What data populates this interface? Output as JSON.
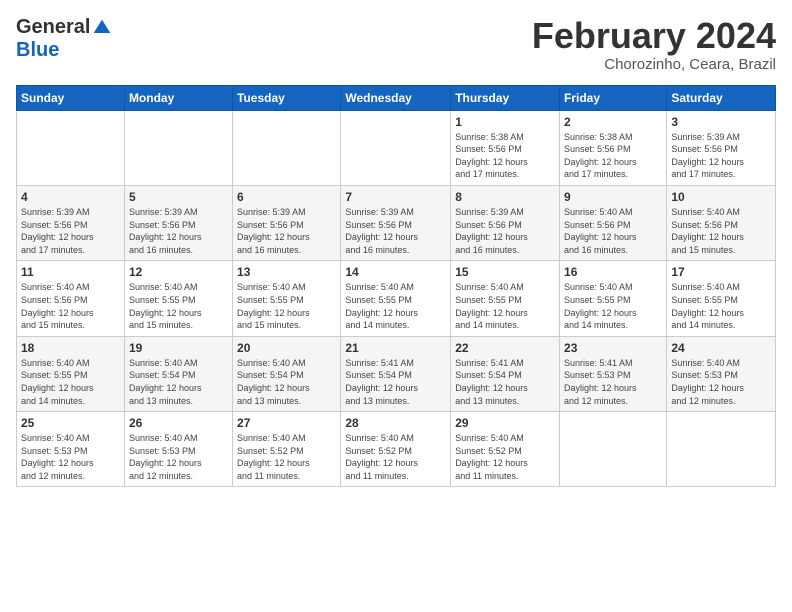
{
  "header": {
    "logo_general": "General",
    "logo_blue": "Blue",
    "month_title": "February 2024",
    "location": "Chorozinho, Ceara, Brazil"
  },
  "weekdays": [
    "Sunday",
    "Monday",
    "Tuesday",
    "Wednesday",
    "Thursday",
    "Friday",
    "Saturday"
  ],
  "weeks": [
    [
      {
        "day": "",
        "info": ""
      },
      {
        "day": "",
        "info": ""
      },
      {
        "day": "",
        "info": ""
      },
      {
        "day": "",
        "info": ""
      },
      {
        "day": "1",
        "info": "Sunrise: 5:38 AM\nSunset: 5:56 PM\nDaylight: 12 hours\nand 17 minutes."
      },
      {
        "day": "2",
        "info": "Sunrise: 5:38 AM\nSunset: 5:56 PM\nDaylight: 12 hours\nand 17 minutes."
      },
      {
        "day": "3",
        "info": "Sunrise: 5:39 AM\nSunset: 5:56 PM\nDaylight: 12 hours\nand 17 minutes."
      }
    ],
    [
      {
        "day": "4",
        "info": "Sunrise: 5:39 AM\nSunset: 5:56 PM\nDaylight: 12 hours\nand 17 minutes."
      },
      {
        "day": "5",
        "info": "Sunrise: 5:39 AM\nSunset: 5:56 PM\nDaylight: 12 hours\nand 16 minutes."
      },
      {
        "day": "6",
        "info": "Sunrise: 5:39 AM\nSunset: 5:56 PM\nDaylight: 12 hours\nand 16 minutes."
      },
      {
        "day": "7",
        "info": "Sunrise: 5:39 AM\nSunset: 5:56 PM\nDaylight: 12 hours\nand 16 minutes."
      },
      {
        "day": "8",
        "info": "Sunrise: 5:39 AM\nSunset: 5:56 PM\nDaylight: 12 hours\nand 16 minutes."
      },
      {
        "day": "9",
        "info": "Sunrise: 5:40 AM\nSunset: 5:56 PM\nDaylight: 12 hours\nand 16 minutes."
      },
      {
        "day": "10",
        "info": "Sunrise: 5:40 AM\nSunset: 5:56 PM\nDaylight: 12 hours\nand 15 minutes."
      }
    ],
    [
      {
        "day": "11",
        "info": "Sunrise: 5:40 AM\nSunset: 5:56 PM\nDaylight: 12 hours\nand 15 minutes."
      },
      {
        "day": "12",
        "info": "Sunrise: 5:40 AM\nSunset: 5:55 PM\nDaylight: 12 hours\nand 15 minutes."
      },
      {
        "day": "13",
        "info": "Sunrise: 5:40 AM\nSunset: 5:55 PM\nDaylight: 12 hours\nand 15 minutes."
      },
      {
        "day": "14",
        "info": "Sunrise: 5:40 AM\nSunset: 5:55 PM\nDaylight: 12 hours\nand 14 minutes."
      },
      {
        "day": "15",
        "info": "Sunrise: 5:40 AM\nSunset: 5:55 PM\nDaylight: 12 hours\nand 14 minutes."
      },
      {
        "day": "16",
        "info": "Sunrise: 5:40 AM\nSunset: 5:55 PM\nDaylight: 12 hours\nand 14 minutes."
      },
      {
        "day": "17",
        "info": "Sunrise: 5:40 AM\nSunset: 5:55 PM\nDaylight: 12 hours\nand 14 minutes."
      }
    ],
    [
      {
        "day": "18",
        "info": "Sunrise: 5:40 AM\nSunset: 5:55 PM\nDaylight: 12 hours\nand 14 minutes."
      },
      {
        "day": "19",
        "info": "Sunrise: 5:40 AM\nSunset: 5:54 PM\nDaylight: 12 hours\nand 13 minutes."
      },
      {
        "day": "20",
        "info": "Sunrise: 5:40 AM\nSunset: 5:54 PM\nDaylight: 12 hours\nand 13 minutes."
      },
      {
        "day": "21",
        "info": "Sunrise: 5:41 AM\nSunset: 5:54 PM\nDaylight: 12 hours\nand 13 minutes."
      },
      {
        "day": "22",
        "info": "Sunrise: 5:41 AM\nSunset: 5:54 PM\nDaylight: 12 hours\nand 13 minutes."
      },
      {
        "day": "23",
        "info": "Sunrise: 5:41 AM\nSunset: 5:53 PM\nDaylight: 12 hours\nand 12 minutes."
      },
      {
        "day": "24",
        "info": "Sunrise: 5:40 AM\nSunset: 5:53 PM\nDaylight: 12 hours\nand 12 minutes."
      }
    ],
    [
      {
        "day": "25",
        "info": "Sunrise: 5:40 AM\nSunset: 5:53 PM\nDaylight: 12 hours\nand 12 minutes."
      },
      {
        "day": "26",
        "info": "Sunrise: 5:40 AM\nSunset: 5:53 PM\nDaylight: 12 hours\nand 12 minutes."
      },
      {
        "day": "27",
        "info": "Sunrise: 5:40 AM\nSunset: 5:52 PM\nDaylight: 12 hours\nand 11 minutes."
      },
      {
        "day": "28",
        "info": "Sunrise: 5:40 AM\nSunset: 5:52 PM\nDaylight: 12 hours\nand 11 minutes."
      },
      {
        "day": "29",
        "info": "Sunrise: 5:40 AM\nSunset: 5:52 PM\nDaylight: 12 hours\nand 11 minutes."
      },
      {
        "day": "",
        "info": ""
      },
      {
        "day": "",
        "info": ""
      }
    ]
  ]
}
